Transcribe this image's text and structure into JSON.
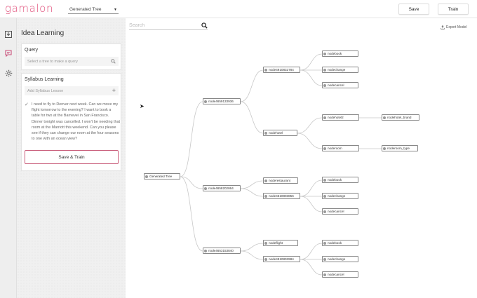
{
  "app": {
    "logo": "gamalon",
    "model_select": "Generated Tree"
  },
  "toolbar": {
    "save_label": "Save",
    "train_label": "Train"
  },
  "rail": {
    "icons": [
      "download-icon",
      "chat-icon",
      "gear-icon"
    ]
  },
  "panel": {
    "title": "Idea Learning",
    "query": {
      "label": "Query",
      "placeholder": "Select a tree to make a query"
    },
    "syllabus": {
      "label": "Syllabus Learning",
      "placeholder": "Add Syllabus Lesson",
      "text": "I need to fly to Denver next week. Can we move my flight tomorrow to the evening? I want to book a table for two at the Barnevei in San Francisco. Dinner tonight was cancelled. I won't be needing that room at the Marriott this weekend. Can you please see if they can change our room at the four seasons to one with an ocean view?"
    },
    "save_train_label": "Save & Train"
  },
  "canvas": {
    "search_placeholder": "Search",
    "export_label": "Export Model"
  },
  "tree": {
    "root": "Generated Tree",
    "nodes": {
      "n1": "node4659133936",
      "n1a": "node4910832784",
      "n1a1": "nodebook",
      "n1a2": "nodechange",
      "n1a3": "nodecancel",
      "n1b": "nodehotel",
      "n1b1": "nodehotel2",
      "n1b1a": "nodehotel_brand",
      "n1b2": "noderoom",
      "n1b2a": "noderoom_type",
      "n2": "node4658202864",
      "n2a": "noderestaurant",
      "n2b": "node4610803856",
      "n2b1": "nodebook",
      "n2b2": "nodechange",
      "n2b3": "nodecancel",
      "n3": "node4653153840",
      "n3a": "nodeflight",
      "n3b": "node4910803984",
      "n3b1": "nodebook",
      "n3b2": "nodechange",
      "n3b3": "nodecancel"
    }
  }
}
